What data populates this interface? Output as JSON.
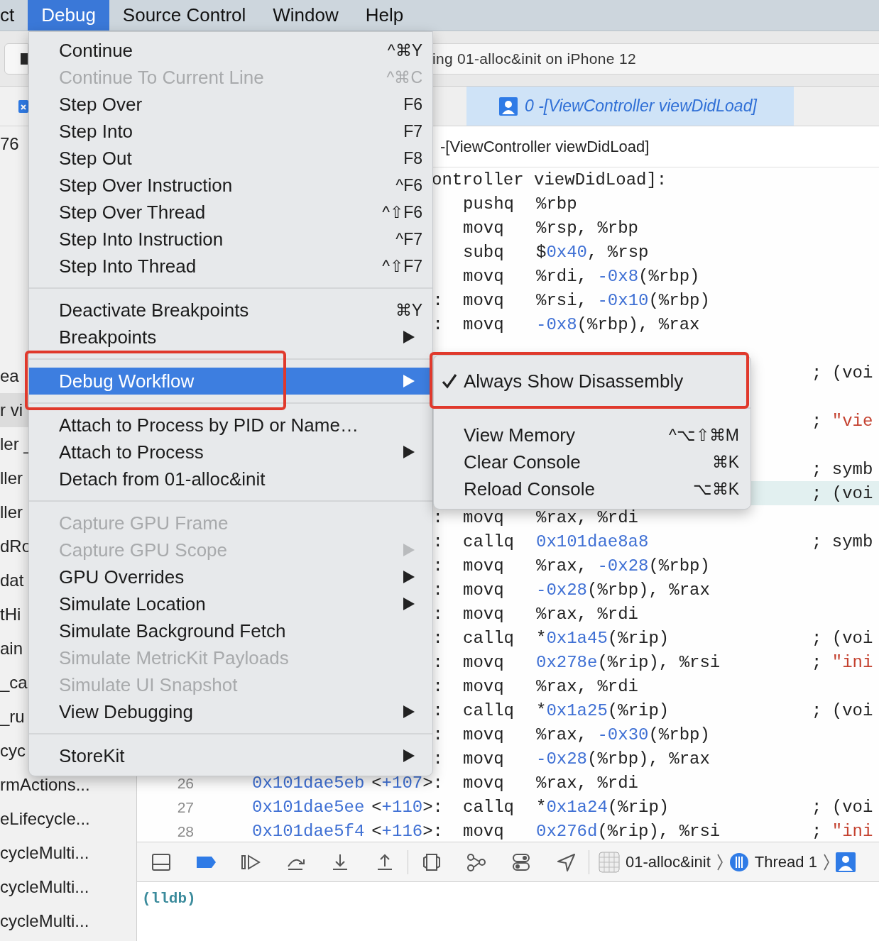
{
  "menubar": [
    {
      "label": "ct",
      "selected": false
    },
    {
      "label": "Debug",
      "selected": true
    },
    {
      "label": "Source Control",
      "selected": false
    },
    {
      "label": "Window",
      "selected": false
    },
    {
      "label": "Help",
      "selected": false
    }
  ],
  "toolbar": {
    "status": "ing 01-alloc&init on iPhone 12"
  },
  "editor_tab": {
    "label": "0 -[ViewController viewDidLoad]",
    "selected": true
  },
  "jump_bar": "-[ViewController viewDidLoad]",
  "sidebar": {
    "groups": [
      {
        "items": [
          {
            "text": "76",
            "selected": false
          }
        ]
      },
      {
        "items": [
          {
            "text": "ea",
            "selected": false
          },
          {
            "text": "r vi",
            "selected": true
          },
          {
            "text": "ler _",
            "selected": false
          },
          {
            "text": "ller",
            "selected": false
          },
          {
            "text": "ller",
            "selected": false
          },
          {
            "text": "dRo",
            "selected": false
          },
          {
            "text": "dat",
            "selected": false
          },
          {
            "text": "tHi",
            "selected": false
          },
          {
            "text": "ain",
            "selected": false
          },
          {
            "text": "_ca",
            "selected": false
          },
          {
            "text": "_ru",
            "selected": false
          },
          {
            "text": "cyc",
            "selected": false
          },
          {
            "text": "rmActions...",
            "selected": false
          },
          {
            "text": "eLifecycle...",
            "selected": false
          },
          {
            "text": "cycleMulti...",
            "selected": false
          },
          {
            "text": "cycleMulti...",
            "selected": false
          },
          {
            "text": "cycleMulti...",
            "selected": false
          }
        ]
      }
    ]
  },
  "code": {
    "lines": [
      {
        "kind": "label",
        "text": "ontroller viewDidLoad]:",
        "highlighted": false
      },
      {
        "kind": "instr",
        "highlighted": false,
        "mnemonic": "pushq",
        "operands": [
          {
            "t": "%rbp",
            "kind": "text"
          }
        ]
      },
      {
        "kind": "instr",
        "highlighted": false,
        "mnemonic": "movq",
        "operands": [
          {
            "t": "%rsp, %rbp",
            "kind": "text"
          }
        ]
      },
      {
        "kind": "instr",
        "highlighted": false,
        "mnemonic": "subq",
        "operands": [
          {
            "t": "$",
            "kind": "text"
          },
          {
            "t": "0x40",
            "kind": "num"
          },
          {
            "t": ", %rsp",
            "kind": "text"
          }
        ]
      },
      {
        "kind": "instr",
        "highlighted": false,
        "mnemonic": "movq",
        "operands": [
          {
            "t": "%rdi, ",
            "kind": "text"
          },
          {
            "t": "-0x8",
            "kind": "num"
          },
          {
            "t": "(%rbp)",
            "kind": "text"
          }
        ]
      },
      {
        "kind": "instr",
        "highlighted": false,
        "offset": [
          {
            "t": ":",
            "kind": "text"
          }
        ],
        "mnemonic": "movq",
        "operands": [
          {
            "t": "%rsi, ",
            "kind": "text"
          },
          {
            "t": "-0x10",
            "kind": "num"
          },
          {
            "t": "(%rbp)",
            "kind": "text"
          }
        ]
      },
      {
        "kind": "instr",
        "highlighted": false,
        "offset": [
          {
            "t": ":",
            "kind": "text"
          }
        ],
        "mnemonic": "movq",
        "operands": [
          {
            "t": "-0x8",
            "kind": "num"
          },
          {
            "t": "(%rbp), %rax",
            "kind": "text"
          }
        ]
      },
      {
        "kind": "blank",
        "highlighted": false
      },
      {
        "kind": "instr",
        "highlighted": false,
        "comment": [
          {
            "t": ";",
            "kind": "text"
          },
          {
            "t": "(voi",
            "kind": "text"
          }
        ]
      },
      {
        "kind": "blank",
        "highlighted": false
      },
      {
        "kind": "instr",
        "highlighted": false,
        "comment": [
          {
            "t": ";",
            "kind": "text"
          },
          {
            "t": "\"vie",
            "kind": "str"
          }
        ]
      },
      {
        "kind": "blank",
        "highlighted": false
      },
      {
        "kind": "instr",
        "highlighted": false,
        "comment": [
          {
            "t": ";",
            "kind": "text"
          },
          {
            "t": "symb",
            "kind": "text"
          }
        ]
      },
      {
        "kind": "instr",
        "highlighted": true,
        "comment": [
          {
            "t": ";",
            "kind": "text"
          },
          {
            "t": "(voi",
            "kind": "text"
          }
        ]
      },
      {
        "kind": "instr",
        "highlighted": false,
        "offset": [
          {
            "t": ":",
            "kind": "text"
          }
        ],
        "mnemonic": "movq",
        "operands": [
          {
            "t": "%rax, %rdi",
            "kind": "text"
          }
        ]
      },
      {
        "kind": "instr",
        "highlighted": false,
        "offset": [
          {
            "t": ":",
            "kind": "text"
          }
        ],
        "mnemonic": "callq",
        "operands": [
          {
            "t": "0x101dae8a8",
            "kind": "num"
          }
        ],
        "comment": [
          {
            "t": ";",
            "kind": "text"
          },
          {
            "t": "symb",
            "kind": "text"
          }
        ]
      },
      {
        "kind": "instr",
        "highlighted": false,
        "offset": [
          {
            "t": ":",
            "kind": "text"
          }
        ],
        "mnemonic": "movq",
        "operands": [
          {
            "t": "%rax, ",
            "kind": "text"
          },
          {
            "t": "-0x28",
            "kind": "num"
          },
          {
            "t": "(%rbp)",
            "kind": "text"
          }
        ]
      },
      {
        "kind": "instr",
        "highlighted": false,
        "offset": [
          {
            "t": ":",
            "kind": "text"
          }
        ],
        "mnemonic": "movq",
        "operands": [
          {
            "t": "-0x28",
            "kind": "num"
          },
          {
            "t": "(%rbp), %rax",
            "kind": "text"
          }
        ]
      },
      {
        "kind": "instr",
        "highlighted": false,
        "offset": [
          {
            "t": ":",
            "kind": "text"
          }
        ],
        "mnemonic": "movq",
        "operands": [
          {
            "t": "%rax, %rdi",
            "kind": "text"
          }
        ]
      },
      {
        "kind": "instr",
        "highlighted": false,
        "offset": [
          {
            "t": ":",
            "kind": "text"
          }
        ],
        "mnemonic": "callq",
        "operands": [
          {
            "t": "*",
            "kind": "text"
          },
          {
            "t": "0x1a45",
            "kind": "num"
          },
          {
            "t": "(%rip)",
            "kind": "text"
          }
        ],
        "comment": [
          {
            "t": ";",
            "kind": "text"
          },
          {
            "t": "(voi",
            "kind": "text"
          }
        ]
      },
      {
        "kind": "instr",
        "highlighted": false,
        "offset": [
          {
            "t": ":",
            "kind": "text"
          }
        ],
        "mnemonic": "movq",
        "operands": [
          {
            "t": "0x278e",
            "kind": "num"
          },
          {
            "t": "(%rip), %rsi",
            "kind": "text"
          }
        ],
        "comment": [
          {
            "t": ";",
            "kind": "text"
          },
          {
            "t": "\"ini",
            "kind": "str"
          }
        ]
      },
      {
        "kind": "instr",
        "highlighted": false,
        "offset": [
          {
            "t": ":",
            "kind": "text"
          }
        ],
        "mnemonic": "movq",
        "operands": [
          {
            "t": "%rax, %rdi",
            "kind": "text"
          }
        ]
      },
      {
        "kind": "instr",
        "highlighted": false,
        "offset": [
          {
            "t": ":",
            "kind": "text"
          }
        ],
        "mnemonic": "callq",
        "operands": [
          {
            "t": "*",
            "kind": "text"
          },
          {
            "t": "0x1a25",
            "kind": "num"
          },
          {
            "t": "(%rip)",
            "kind": "text"
          }
        ],
        "comment": [
          {
            "t": ";",
            "kind": "text"
          },
          {
            "t": "(voi",
            "kind": "text"
          }
        ]
      },
      {
        "kind": "instr",
        "highlighted": false,
        "offset": [
          {
            "t": ":",
            "kind": "text"
          }
        ],
        "mnemonic": "movq",
        "operands": [
          {
            "t": "%rax, ",
            "kind": "text"
          },
          {
            "t": "-0x30",
            "kind": "num"
          },
          {
            "t": "(%rbp)",
            "kind": "text"
          }
        ]
      },
      {
        "kind": "instr",
        "highlighted": false,
        "offset": [
          {
            "t": ":",
            "kind": "text"
          }
        ],
        "mnemonic": "movq",
        "operands": [
          {
            "t": "-0x28",
            "kind": "num"
          },
          {
            "t": "(%rbp), %rax",
            "kind": "text"
          }
        ]
      },
      {
        "kind": "instr",
        "highlighted": false,
        "line": "26",
        "address": "0x101dae5eb",
        "offset": [
          {
            "t": "<",
            "kind": "text"
          },
          {
            "t": "+107",
            "kind": "num"
          },
          {
            "t": ">:",
            "kind": "text"
          }
        ],
        "mnemonic": "movq",
        "operands": [
          {
            "t": "%rax, %rdi",
            "kind": "text"
          }
        ]
      },
      {
        "kind": "instr",
        "highlighted": false,
        "line": "27",
        "address": "0x101dae5ee",
        "offset": [
          {
            "t": "<",
            "kind": "text"
          },
          {
            "t": "+110",
            "kind": "num"
          },
          {
            "t": ">:",
            "kind": "text"
          }
        ],
        "mnemonic": "callq",
        "operands": [
          {
            "t": "*",
            "kind": "text"
          },
          {
            "t": "0x1a24",
            "kind": "num"
          },
          {
            "t": "(%rip)",
            "kind": "text"
          }
        ],
        "comment": [
          {
            "t": ";",
            "kind": "text"
          },
          {
            "t": "(voi",
            "kind": "text"
          }
        ]
      },
      {
        "kind": "instr",
        "highlighted": false,
        "line": "28",
        "address": "0x101dae5f4",
        "offset": [
          {
            "t": "<",
            "kind": "text"
          },
          {
            "t": "+116",
            "kind": "num"
          },
          {
            "t": ">:",
            "kind": "text"
          }
        ],
        "mnemonic": "movq",
        "operands": [
          {
            "t": "0x276d",
            "kind": "num"
          },
          {
            "t": "(%rip), %rsi",
            "kind": "text"
          }
        ],
        "comment": [
          {
            "t": ";",
            "kind": "text"
          },
          {
            "t": "\"ini",
            "kind": "str"
          }
        ]
      }
    ]
  },
  "debug_bar": {
    "buttons": [
      {
        "kind": "panel",
        "on": false
      },
      {
        "kind": "breakpoints",
        "on": true
      },
      {
        "kind": "continue",
        "on": false
      },
      {
        "kind": "step-over",
        "on": false
      },
      {
        "kind": "step-into",
        "on": false
      },
      {
        "kind": "step-out",
        "on": false
      },
      {
        "kind": "divider"
      },
      {
        "kind": "view-hierarchy",
        "on": false
      },
      {
        "kind": "memory-graph",
        "on": false
      },
      {
        "kind": "environment",
        "on": false
      },
      {
        "kind": "location",
        "on": false
      },
      {
        "kind": "divider"
      }
    ],
    "path": [
      {
        "kind": "scheme",
        "label": "01-alloc&init"
      },
      {
        "kind": "thread",
        "label": "Thread 1"
      },
      {
        "kind": "frame"
      }
    ]
  },
  "console": {
    "prompt": "(lldb)"
  },
  "debug_menu": {
    "items": [
      {
        "kind": "item",
        "label": "Continue",
        "shortcut": "^⌘Y",
        "disabled": false,
        "selected": false,
        "submenu": false
      },
      {
        "kind": "item",
        "label": "Continue To Current Line",
        "shortcut": "^⌘C",
        "disabled": true,
        "selected": false,
        "submenu": false
      },
      {
        "kind": "item",
        "label": "Step Over",
        "shortcut": "F6",
        "disabled": false,
        "selected": false,
        "submenu": false
      },
      {
        "kind": "item",
        "label": "Step Into",
        "shortcut": "F7",
        "disabled": false,
        "selected": false,
        "submenu": false
      },
      {
        "kind": "item",
        "label": "Step Out",
        "shortcut": "F8",
        "disabled": false,
        "selected": false,
        "submenu": false
      },
      {
        "kind": "item",
        "label": "Step Over Instruction",
        "shortcut": "^F6",
        "disabled": false,
        "selected": false,
        "submenu": false
      },
      {
        "kind": "item",
        "label": "Step Over Thread",
        "shortcut": "^⇧F6",
        "disabled": false,
        "selected": false,
        "submenu": false
      },
      {
        "kind": "item",
        "label": "Step Into Instruction",
        "shortcut": "^F7",
        "disabled": false,
        "selected": false,
        "submenu": false
      },
      {
        "kind": "item",
        "label": "Step Into Thread",
        "shortcut": "^⇧F7",
        "disabled": false,
        "selected": false,
        "submenu": false
      },
      {
        "kind": "separator"
      },
      {
        "kind": "item",
        "label": "Deactivate Breakpoints",
        "shortcut": "⌘Y",
        "disabled": false,
        "selected": false,
        "submenu": false
      },
      {
        "kind": "item",
        "label": "Breakpoints",
        "disabled": false,
        "selected": false,
        "submenu": true
      },
      {
        "kind": "separator"
      },
      {
        "kind": "item",
        "label": "Debug Workflow",
        "disabled": false,
        "selected": true,
        "submenu": true,
        "annotated": true
      },
      {
        "kind": "separator"
      },
      {
        "kind": "item",
        "label": "Attach to Process by PID or Name…",
        "disabled": false,
        "selected": false,
        "submenu": false
      },
      {
        "kind": "item",
        "label": "Attach to Process",
        "disabled": false,
        "selected": false,
        "submenu": true
      },
      {
        "kind": "item",
        "label": "Detach from 01-alloc&init",
        "disabled": false,
        "selected": false,
        "submenu": false
      },
      {
        "kind": "separator"
      },
      {
        "kind": "item",
        "label": "Capture GPU Frame",
        "disabled": true,
        "selected": false,
        "submenu": false
      },
      {
        "kind": "item",
        "label": "Capture GPU Scope",
        "disabled": true,
        "selected": false,
        "submenu": true
      },
      {
        "kind": "item",
        "label": "GPU Overrides",
        "disabled": false,
        "selected": false,
        "submenu": true
      },
      {
        "kind": "item",
        "label": "Simulate Location",
        "disabled": false,
        "selected": false,
        "submenu": true
      },
      {
        "kind": "item",
        "label": "Simulate Background Fetch",
        "disabled": false,
        "selected": false,
        "submenu": false
      },
      {
        "kind": "item",
        "label": "Simulate MetricKit Payloads",
        "disabled": true,
        "selected": false,
        "submenu": false
      },
      {
        "kind": "item",
        "label": "Simulate UI Snapshot",
        "disabled": true,
        "selected": false,
        "submenu": false
      },
      {
        "kind": "item",
        "label": "View Debugging",
        "disabled": false,
        "selected": false,
        "submenu": true
      },
      {
        "kind": "separator"
      },
      {
        "kind": "item",
        "label": "StoreKit",
        "disabled": false,
        "selected": false,
        "submenu": true
      }
    ]
  },
  "workflow_submenu": {
    "items": [
      {
        "kind": "item",
        "label": "Always Show Disassembly",
        "checked": true,
        "annotated": true
      },
      {
        "kind": "separator"
      },
      {
        "kind": "item",
        "label": "View Memory",
        "shortcut": "^⌥⇧⌘M",
        "checked": false
      },
      {
        "kind": "item",
        "label": "Clear Console",
        "shortcut": "⌘K",
        "checked": false
      },
      {
        "kind": "item",
        "label": "Reload Console",
        "shortcut": "⌥⌘K",
        "checked": false
      }
    ]
  }
}
